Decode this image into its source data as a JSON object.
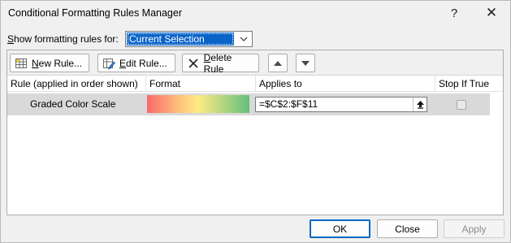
{
  "window": {
    "title": "Conditional Formatting Rules Manager",
    "help_glyph": "?",
    "close_glyph": "✕"
  },
  "show_for": {
    "label": "Show formatting rules for:",
    "selected": "Current Selection"
  },
  "toolbar": {
    "new_rule": "New Rule...",
    "edit_rule": "Edit Rule...",
    "delete_rule": "Delete Rule"
  },
  "table": {
    "headers": {
      "rule": "Rule (applied in order shown)",
      "format": "Format",
      "applies_to": "Applies to",
      "stop_if_true": "Stop If True"
    },
    "rows": [
      {
        "rule": "Graded Color Scale",
        "applies_to": "=$C$2:$F$11",
        "stop_if_true": false,
        "format_colors": [
          "#f8696b",
          "#ffeb84",
          "#63be7b"
        ]
      }
    ]
  },
  "footer": {
    "ok": "OK",
    "close": "Close",
    "apply": "Apply"
  },
  "colors": {
    "accent": "#0067c0",
    "selection": "#0a64c8"
  }
}
